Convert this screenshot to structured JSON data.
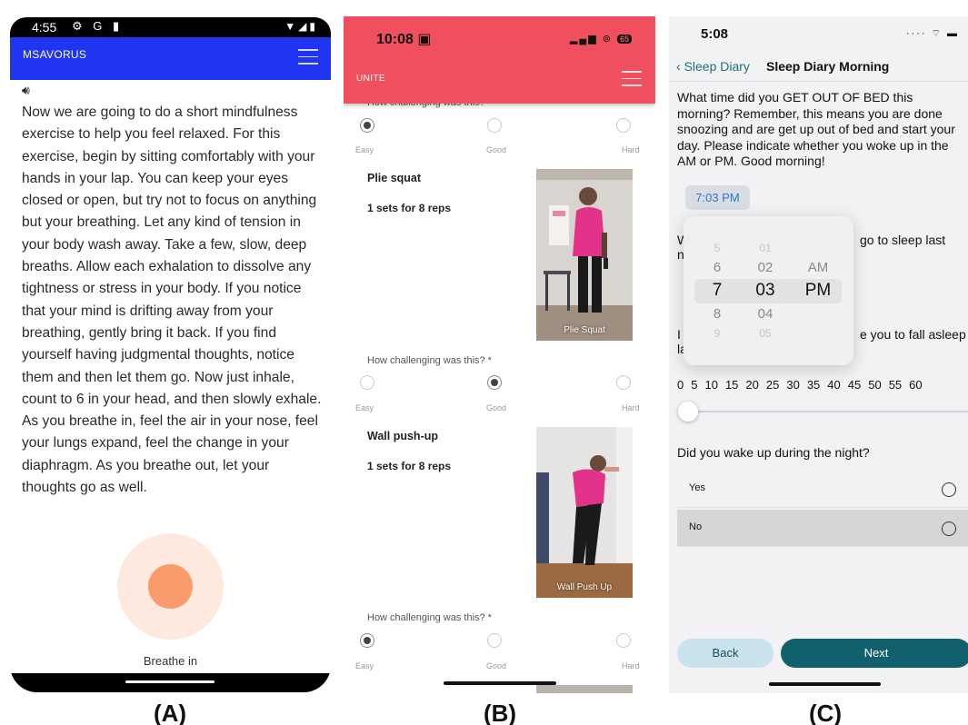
{
  "captions": {
    "a": "(A)",
    "b": "(B)",
    "c": "(C)"
  },
  "panel_a": {
    "status_time": "4:55",
    "app_title": "MSAVORUS",
    "body_text": "Now we are going to do a short mindfulness exercise to help you feel relaxed. For this exercise, begin by sitting comfortably with your hands in your lap. You can keep your eyes closed or open, but try not to focus on anything but your breathing. Let any kind of tension in your body wash away. Take a few, slow, deep breaths. Allow each exhalation to dissolve any tightness or stress in your body. If you notice that your mind is drifting away from your breathing, gently bring it back. If you find yourself having judgmental thoughts, notice them and then let them go. Now just inhale, count to 6 in your head, and then slowly exhale. As you breathe in, feel the air in your nose, feel your lungs expand, feel the change in your diaphragm. As you breathe out, let your thoughts go as well.",
    "breathe_label": "Breathe in",
    "colors": {
      "appbar": "#1f35f2",
      "breathe_outer": "#fde9de",
      "breathe_inner": "#fb9a6a"
    }
  },
  "panel_b": {
    "status_time": "10:08",
    "battery": "65",
    "app_title": "UNITE",
    "question_partial": "How challenging was this?",
    "question": "How challenging was this? *",
    "options": {
      "easy": "Easy",
      "good": "Good",
      "hard": "Hard"
    },
    "ratings": [
      "Easy",
      "Good",
      "Easy"
    ],
    "exercises": [
      {
        "name": "Plie squat",
        "reps": "1 sets for 8 reps",
        "photo_caption": "Plie Squat"
      },
      {
        "name": "Wall push-up",
        "reps": "1 sets for 8 reps",
        "photo_caption": "Wall Push Up"
      }
    ],
    "colors": {
      "header": "#f0505e"
    }
  },
  "panel_c": {
    "status_time": "5:08",
    "nav_back": "Sleep Diary",
    "nav_title": "Sleep Diary Morning",
    "q_out_of_bed": "What time did you GET OUT OF BED this morning? Remember, this means you are done snoozing and are get up out of bed and start your day. Please indicate whether you woke up in the AM or PM. Good morning!",
    "time_value": "7:03 PM",
    "q2_start": "W",
    "q2_start_line2": "n",
    "q2_end": "go to sleep last",
    "q3_start": "I",
    "q3_start_line2": "la",
    "q3_end": "e you to fall asleep",
    "picker": {
      "hours": [
        "5",
        "6",
        "7",
        "8",
        "9"
      ],
      "minutes": [
        "01",
        "02",
        "03",
        "04",
        "05"
      ],
      "periods": [
        "AM",
        "PM"
      ],
      "selected": {
        "hour": "7",
        "minute": "03",
        "period": "PM"
      }
    },
    "slider_ticks": [
      "0",
      "5",
      "10",
      "15",
      "20",
      "25",
      "30",
      "35",
      "40",
      "45",
      "50",
      "55",
      "60"
    ],
    "slider_value": 0,
    "q_wake": "Did you wake up during the night?",
    "options": [
      {
        "label": "Yes",
        "selected": false
      },
      {
        "label": "No",
        "selected": false
      }
    ],
    "back_label": "Back",
    "next_label": "Next",
    "colors": {
      "accent": "#10606e",
      "back_btn": "#c9e2ec",
      "chip_text": "#2f74d0"
    }
  }
}
